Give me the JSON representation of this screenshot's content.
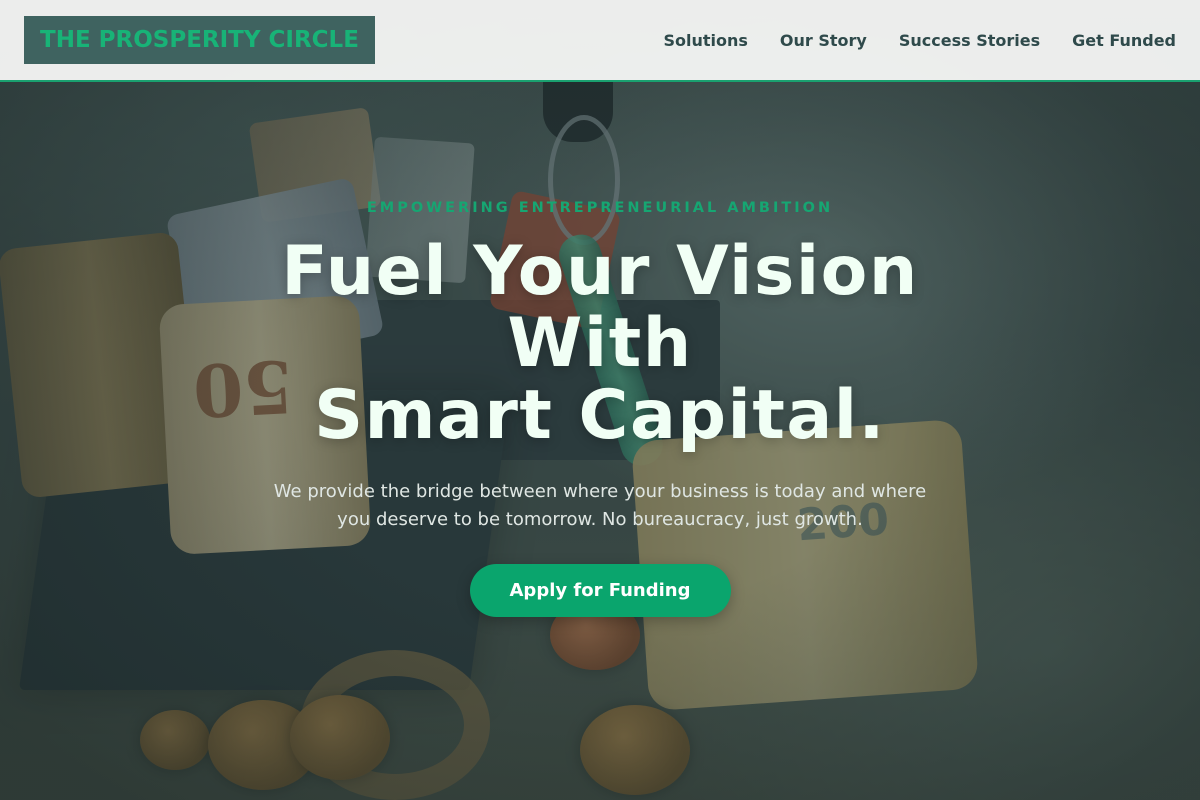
{
  "brand": {
    "name": "THE PROSPERITY CIRCLE",
    "accent_color": "#18b377",
    "logo_background": "#3f6360"
  },
  "nav": {
    "items": [
      {
        "label": "Solutions"
      },
      {
        "label": "Our Story"
      },
      {
        "label": "Success Stories"
      },
      {
        "label": "Get Funded"
      }
    ]
  },
  "hero": {
    "eyebrow": "EMPOWERING ENTREPRENEURIAL AMBITION",
    "headline_lines": [
      "Fuel Your Vision",
      "With",
      "Smart Capital."
    ],
    "subtext": "We provide the bridge between where your business is today and where you deserve to be tomorrow. No bureaucracy, just growth.",
    "cta_label": "Apply for Funding",
    "cta_color": "#0aa56d",
    "background_image": "money-rolls-coins-and-key-photo"
  }
}
